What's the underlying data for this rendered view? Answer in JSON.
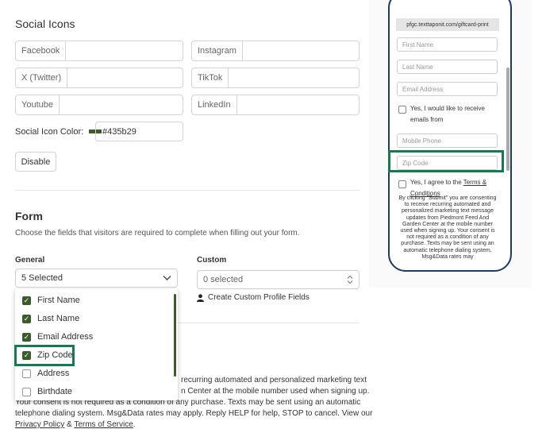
{
  "social": {
    "heading": "Social Icons",
    "fields": [
      {
        "label": "Facebook",
        "value": ""
      },
      {
        "label": "Instagram",
        "value": ""
      },
      {
        "label": "X (Twitter)",
        "value": ""
      },
      {
        "label": "TikTok",
        "value": ""
      },
      {
        "label": "Youtube",
        "value": ""
      },
      {
        "label": "LinkedIn",
        "value": ""
      }
    ],
    "color_label": "Social Icon Color:",
    "color_value": "#435b29",
    "disable_label": "Disable"
  },
  "form": {
    "heading": "Form",
    "description": "Choose the fields that visitors are required to complete when filling out your form.",
    "general_label": "General",
    "general_selected": "5 Selected",
    "custom_label": "Custom",
    "custom_selected": "0 selected",
    "create_custom_label": "Create Custom Profile Fields",
    "options": [
      {
        "label": "First Name",
        "checked": true
      },
      {
        "label": "Last Name",
        "checked": true
      },
      {
        "label": "Email Address",
        "checked": true
      },
      {
        "label": "Zip Code",
        "checked": true
      },
      {
        "label": "Address",
        "checked": false
      },
      {
        "label": "Birthdate",
        "checked": false
      }
    ]
  },
  "consent": {
    "line1": "recurring automated and personalized marketing text",
    "line2": "n Center at the mobile number used when signing up.",
    "line3": "Your consent is not required as a condition of any purchase. Texts may be sent using an automatic",
    "line4": "telephone dialing system. Msg&Data rates may apply. Reply HELP for help, STOP to cancel. View our",
    "privacy": "Privacy Policy",
    "amp": "&",
    "terms": "Terms of Service",
    "period": "."
  },
  "preview": {
    "url": "pfgc.texttaponit.com/giftcard-print",
    "first_name": "First Name",
    "last_name": "Last Name",
    "email": "Email Address",
    "receive_emails_1": "Yes, I would like to receive",
    "receive_emails_2": "emails from",
    "mobile": "Mobile Phone",
    "zip": "Zip Code",
    "agree_1": "Yes, I agree to the",
    "agree_terms": "Terms &",
    "agree_conditions": "Conditions",
    "disclaimer": "By clicking \"Submit\" you are consenting to receive recurring automated and personalized marketing text message updates from Piedmont Feed And Garden Center at the mobile number used when signing up. Your consent is not required as a condition of any purchase. Texts may be sent using an automatic telephone dialing system. Msg&Data rates may"
  },
  "colors": {
    "accent": "#3b5c2a",
    "highlight": "#157a52",
    "phone_border": "#1e3a5f"
  }
}
